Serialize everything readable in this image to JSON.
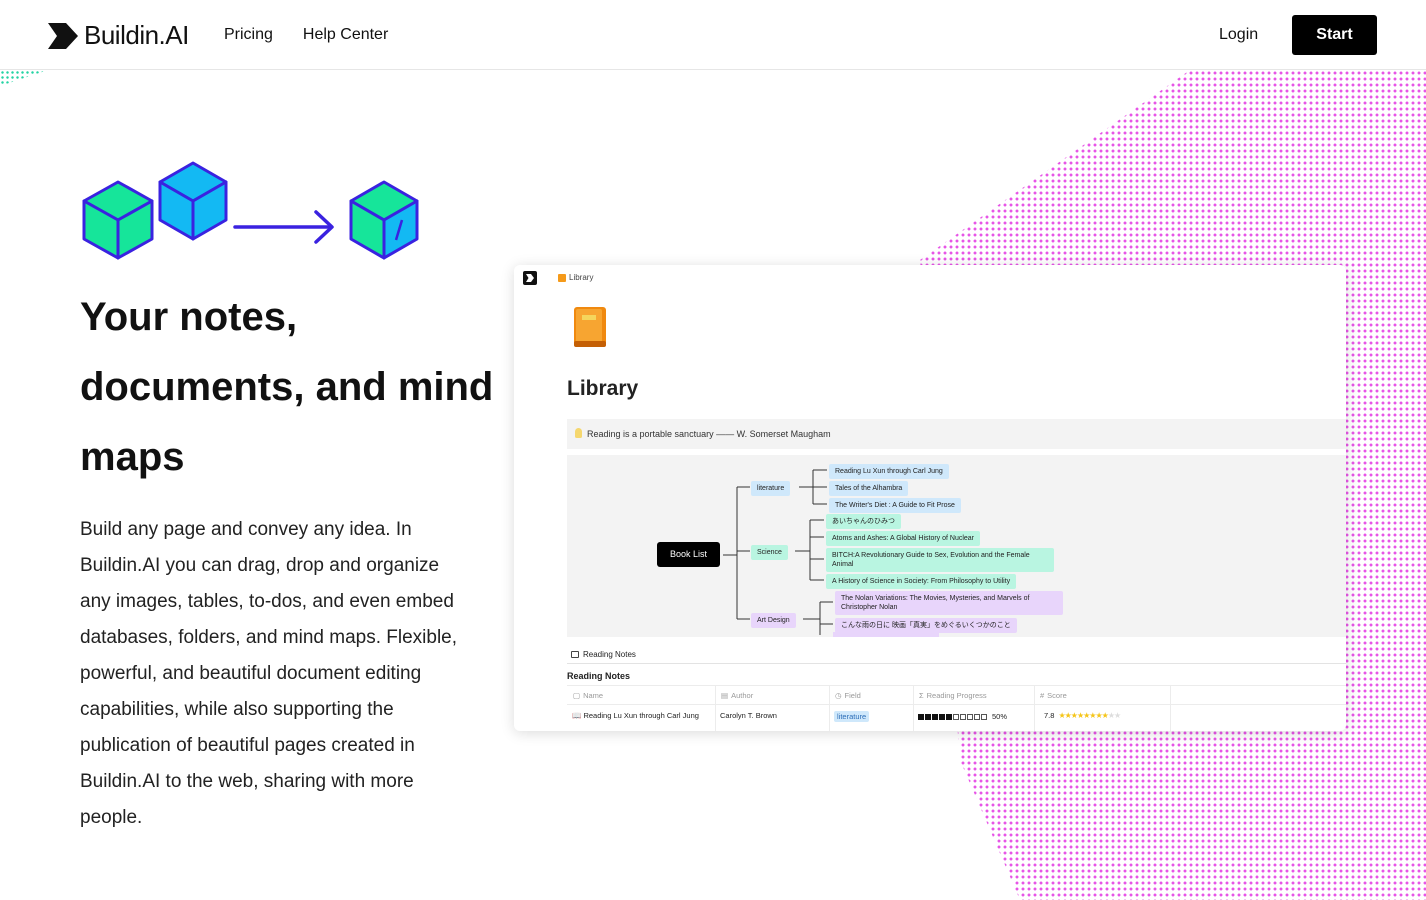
{
  "header": {
    "brand": "Buildin.AI",
    "nav": [
      {
        "label": "Pricing"
      },
      {
        "label": "Help Center"
      }
    ],
    "login_label": "Login",
    "start_label": "Start"
  },
  "hero": {
    "title": "Your notes, documents, and mind maps",
    "description": "Build any page and convey any idea. In Buildin.AI you can drag, drop and organize any images, tables, to-dos, and even embed databases, folders, and mind maps. Flexible, powerful, and beautiful document editing capabilities, while also supporting the publication of beautiful pages created in Buildin.AI to the web, sharing with more people."
  },
  "preview": {
    "breadcrumb": "Library",
    "page_title": "Library",
    "quote": "Reading is a portable sanctuary —— W. Somerset Maugham",
    "mindmap": {
      "root": "Book List",
      "branches": [
        {
          "label": "literature",
          "color": "blue",
          "children": [
            "Reading Lu Xun through Carl Jung",
            "Tales of the Alhambra",
            "The Writer's Diet : A Guide to Fit Prose"
          ]
        },
        {
          "label": "Science",
          "color": "green",
          "children": [
            "あいちゃんのひみつ",
            "Atoms and Ashes: A Global History of Nuclear",
            "BITCH:A Revolutionary Guide to Sex, Evolution and the Female Animal",
            "A History of Science in Society: From Philosophy to Utility"
          ]
        },
        {
          "label": "Art Design",
          "color": "purple",
          "children": [
            "The Nolan Variations: The Movies, Mysteries, and Marvels of Christopher Nolan",
            "こんな雨の日に 映画「真実」をめぐるいくつかのこと"
          ]
        }
      ]
    },
    "table": {
      "tab_label": "Reading Notes",
      "title": "Reading Notes",
      "columns": [
        "Name",
        "Author",
        "Field",
        "Reading Progress",
        "Score"
      ],
      "rows": [
        {
          "name": "Reading Lu Xun through Carl Jung",
          "author": "Carolyn T. Brown",
          "field": "literature",
          "progress": 0.5,
          "progress_label": "50%",
          "score": "7.8"
        }
      ]
    }
  },
  "colors": {
    "accent_magenta": "#e64ce6",
    "accent_green": "#22d3a3",
    "cube_blue": "#13b9f3",
    "cube_green": "#16e59a",
    "cube_outline": "#3a22e0"
  }
}
